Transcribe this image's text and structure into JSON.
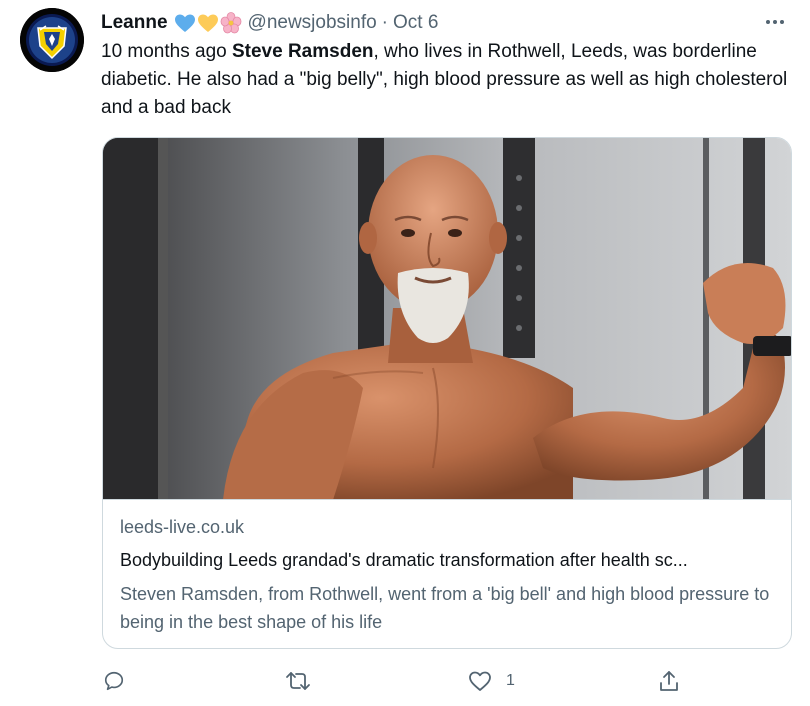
{
  "tweet": {
    "author_name": "Leanne",
    "author_emojis": [
      "blue-heart",
      "yellow-heart",
      "cherry-blossom"
    ],
    "handle": "@newsjobsinfo",
    "separator": "·",
    "date": "Oct 6",
    "text_parts": {
      "p1": "10 months ago ",
      "p2": "Steve Ramsden",
      "p3": ", who lives in Rothwell, Leeds, was borderline diabetic. He also had a \"big belly\", high blood pressure as well as high cholesterol and a bad back"
    }
  },
  "card": {
    "image_subject": "bald bearded man flexing bicep in gym",
    "domain": "leeds-live.co.uk",
    "title": "Bodybuilding Leeds grandad's dramatic transformation after health sc...",
    "description": "Steven Ramsden, from Rothwell, went from a 'big bell' and high blood pressure to being in the best shape of his life"
  },
  "actions": {
    "reply_count": "",
    "retweet_count": "",
    "like_count": "1",
    "share_count": ""
  },
  "colors": {
    "text": "#0f1419",
    "secondary": "#536471",
    "border": "#cfd9de",
    "avatar_bg": "#050505",
    "crest_yellow": "#f4d000",
    "crest_blue": "#1d428a"
  }
}
